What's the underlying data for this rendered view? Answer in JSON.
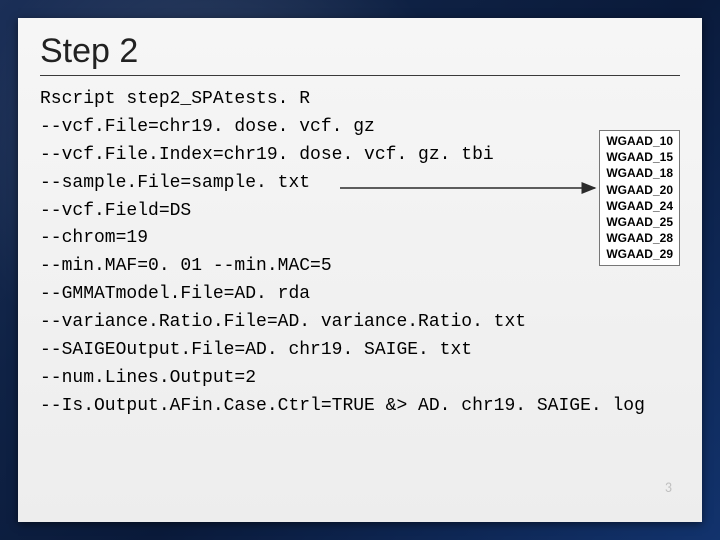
{
  "title": "Step 2",
  "code": {
    "l0": "Rscript step2_SPAtests. R",
    "l1": "--vcf.File=chr19. dose. vcf. gz",
    "l2": "--vcf.File.Index=chr19. dose. vcf. gz. tbi",
    "l3": "--sample.File=sample. txt",
    "l4": "--vcf.Field=DS",
    "l5": "--chrom=19",
    "l6": "--min.MAF=0. 01 --min.MAC=5",
    "l7": "--GMMATmodel.File=AD. rda",
    "l8": "--variance.Ratio.File=AD. variance.Ratio. txt",
    "l9": "--SAIGEOutput.File=AD. chr19. SAIGE. txt",
    "l10": "--num.Lines.Output=2",
    "l11": "--Is.Output.AFin.Case.Ctrl=TRUE &> AD. chr19. SAIGE. log"
  },
  "samples": {
    "s0": "WGAAD_10",
    "s1": "WGAAD_15",
    "s2": "WGAAD_18",
    "s3": "WGAAD_20",
    "s4": "WGAAD_24",
    "s5": "WGAAD_25",
    "s6": "WGAAD_28",
    "s7": "WGAAD_29"
  },
  "page_number": "3"
}
